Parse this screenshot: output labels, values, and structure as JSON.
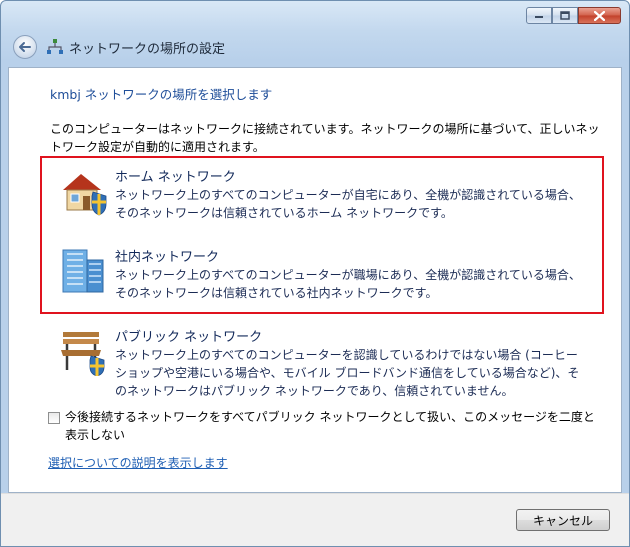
{
  "window": {
    "title": "ネットワークの場所の設定",
    "icons": {
      "minimize": "minimize-icon",
      "maximize": "maximize-icon",
      "close": "close-icon",
      "back": "back-arrow-icon",
      "title": "network-icon"
    }
  },
  "content": {
    "heading": "kmbj ネットワークの場所を選択します",
    "intro": "このコンピューターはネットワークに接続されています。ネットワークの場所に基づいて、正しいネットワーク設定が自動的に適用されます。",
    "options": [
      {
        "icon": "home-network-icon",
        "title": "ホーム ネットワーク",
        "desc_line1": "ネットワーク上のすべてのコンピューターが自宅にあり、全機が認識されている場合、",
        "desc_line2": "そのネットワークは信頼されているホーム ネットワークです。"
      },
      {
        "icon": "work-network-icon",
        "title": "社内ネットワーク",
        "desc_line1": "ネットワーク上のすべてのコンピューターが職場にあり、全機が認識されている場合、",
        "desc_line2": "そのネットワークは信頼されている社内ネットワークです。"
      },
      {
        "icon": "public-network-icon",
        "title": "パブリック ネットワーク",
        "desc_line1": "ネットワーク上のすべてのコンピューターを認識しているわけではない場合 (コーヒー",
        "desc_line2": "ショップや空港にいる場合や、モバイル ブロードバンド通信をしている場合など)、そ",
        "desc_line3": "のネットワークはパブリック ネットワークであり、信頼されていません。"
      }
    ],
    "checkbox": {
      "label": "今後接続するネットワークをすべてパブリック ネットワークとして扱い、このメッセージを二度と表示しない",
      "checked": false
    },
    "help_link": "選択についての説明を表示します"
  },
  "footer": {
    "cancel_label": "キャンセル"
  },
  "colors": {
    "highlight_border": "#e0131e",
    "heading_text": "#1f4e99",
    "link": "#1f5fb4"
  }
}
